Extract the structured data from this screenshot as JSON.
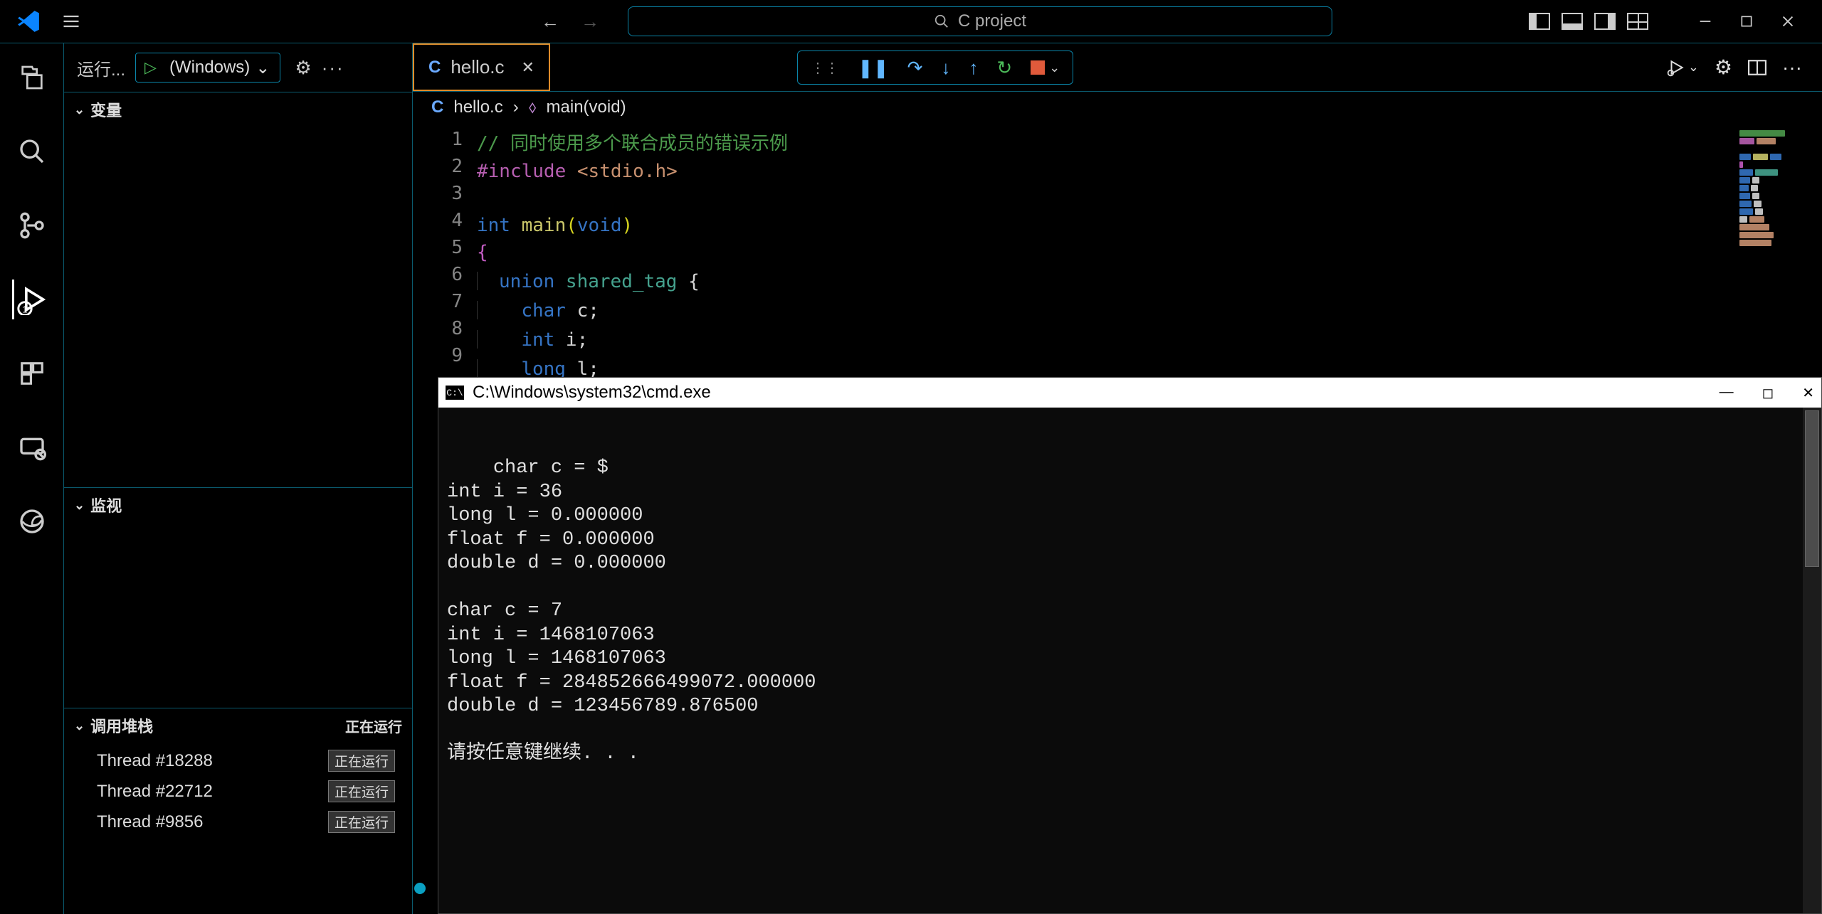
{
  "titlebar": {
    "search_placeholder": "C project"
  },
  "sidebar": {
    "run_label": "运行...",
    "config_label": "(Windows)",
    "panes": {
      "variables": "变量",
      "watch": "监视",
      "callstack": "调用堆栈",
      "callstack_status": "正在运行"
    },
    "threads": [
      {
        "label": "Thread #18288",
        "status": "正在运行"
      },
      {
        "label": "Thread #22712",
        "status": "正在运行"
      },
      {
        "label": "Thread #9856",
        "status": "正在运行"
      }
    ]
  },
  "tab": {
    "filename": "hello.c"
  },
  "breadcrumb": {
    "filename": "hello.c",
    "symbol": "main(void)"
  },
  "code": {
    "line_numbers": [
      "1",
      "2",
      "3",
      "4",
      "5",
      "6",
      "7",
      "8",
      "9"
    ],
    "l1_comment": "// 同时使用多个联合成员的错误示例",
    "l2_pre": "#include ",
    "l2_str": "<stdio.h>",
    "l4_kw": "int ",
    "l4_ident": "main",
    "l4_paren_open": "(",
    "l4_void": "void",
    "l4_paren_close": ")",
    "l5_brace": "{",
    "l6_kw": "union ",
    "l6_type": "shared_tag",
    "l6_rest": " {",
    "l7_kw": "char",
    "l7_rest": " c;",
    "l8_kw": "int",
    "l8_rest": " i;",
    "l9_kw": "long",
    "l9_rest": " l;"
  },
  "console": {
    "title": "C:\\Windows\\system32\\cmd.exe",
    "output": "char c = $\nint i = 36\nlong l = 0.000000\nfloat f = 0.000000\ndouble d = 0.000000\n\nchar c = 7\nint i = 1468107063\nlong l = 1468107063\nfloat f = 284852666499072.000000\ndouble d = 123456789.876500\n\n请按任意键继续. . . "
  }
}
